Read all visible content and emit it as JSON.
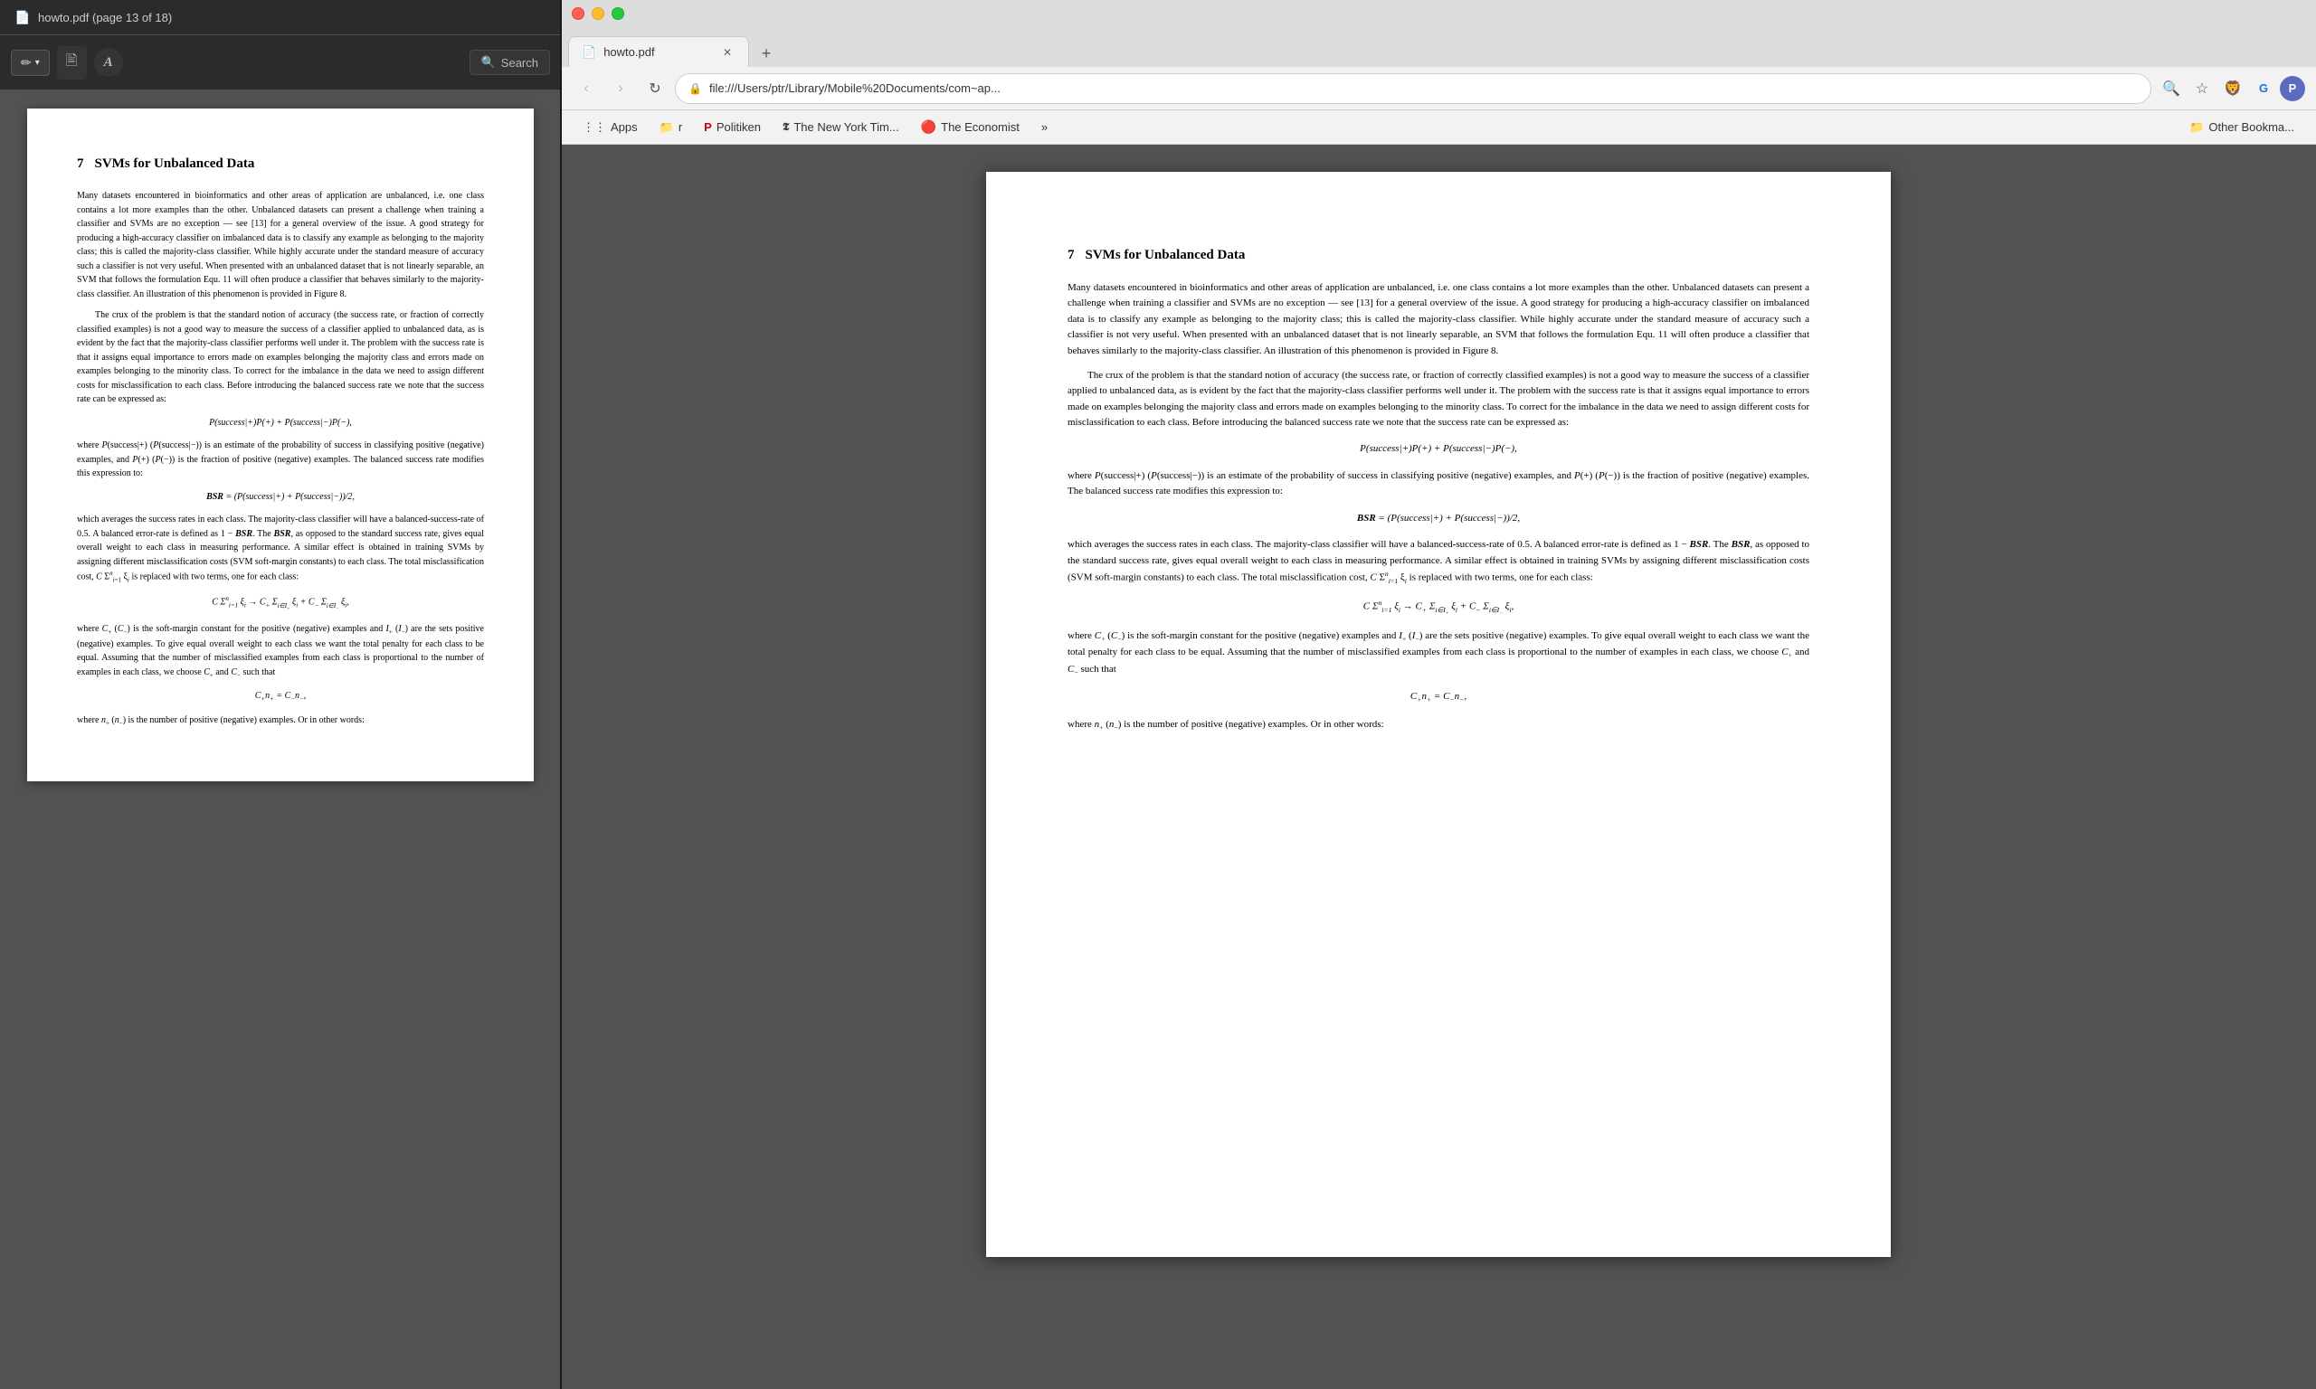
{
  "left_panel": {
    "title": "howto.pdf (page 13 of 18)",
    "toolbar": {
      "pen_label": "✏",
      "pen_dropdown": "▾",
      "stamp_label": "🖹",
      "typewriter_label": "A",
      "search_label": "Search"
    }
  },
  "browser": {
    "tab": {
      "label": "howto.pdf",
      "icon": "📄"
    },
    "address": "file:///Users/ptr/Library/Mobile%20Documents/com~ap...",
    "bookmarks": [
      {
        "type": "apps",
        "label": "Apps",
        "icon": "⋮⋮⋮"
      },
      {
        "type": "folder",
        "label": "r",
        "icon": "📁"
      },
      {
        "type": "site",
        "label": "Politiken",
        "icon": "P"
      },
      {
        "type": "site",
        "label": "The New York Tim...",
        "icon": "NYT"
      },
      {
        "type": "site",
        "label": "The Economist",
        "icon": "🔴"
      },
      {
        "type": "more",
        "label": "»",
        "icon": ""
      },
      {
        "type": "folder",
        "label": "Other Bookma...",
        "icon": "📁"
      }
    ]
  },
  "pdf_content": {
    "section_number": "7",
    "section_title": "SVMs for Unbalanced Data",
    "paragraphs": [
      "Many datasets encountered in bioinformatics and other areas of application are unbalanced, i.e. one class contains a lot more examples than the other.  Unbalanced datasets can present a challenge when training a classifier and SVMs are no exception — see [13] for a general overview of the issue.  A good strategy for producing a high-accuracy classifier on imbalanced data is to classify any example as belonging to the majority class; this is called the majority-class classifier.  While highly accurate under the standard measure of accuracy such a classifier is not very useful.  When presented with an unbalanced dataset that is not linearly separable, an SVM that follows the formulation Equ. 11 will often produce a classifier that behaves similarly to the majority-class classifier.  An illustration of this phenomenon is provided in Figure 8.",
      "The crux of the problem is that the standard notion of accuracy (the success rate, or fraction of correctly classified examples) is not a good way to measure the success of a classifier applied to unbalanced data, as is evident by the fact that the majority-class classifier performs well under it.  The problem with the success rate is that it assigns equal importance to errors made on examples belonging the majority class and errors made on examples belonging to the minority class.  To correct for the imbalance in the data we need to assign different costs for misclassification to each class.  Before introducing the balanced success rate we note that the success rate can be expressed as:"
    ],
    "formula1": "P(success|+)P(+) + P(success|−)P(−),",
    "para2": "where P(success|+) (P(success|−)) is an estimate of the probability of success in classifying positive (negative) examples, and P(+) (P(−)) is the fraction of positive (negative) examples.  The balanced success rate modifies this expression to:",
    "formula2": "BSR = (P(success|+) + P(success|−))/2,",
    "para3": "which averages the success rates in each class.  The majority-class classifier will have a balanced-success-rate of 0.5.  A balanced error-rate is defined as 1 − BSR.  The BSR, as opposed to the standard success rate, gives equal overall weight to each class in measuring performance.  A similar effect is obtained in training SVMs by assigning different misclassification costs (SVM soft-margin constants) to each class.  The total misclassification cost, C Σⁿᵢ₌₁ ξᵢ is replaced with two terms, one for each class:",
    "formula3": "C Σⁿᵢ₌₁ ξᵢ → C₊ Σᵢ∈I₊ ξᵢ + C₋ Σᵢ∈I₋ ξᵢ,",
    "para4": "where C₊ (C₋) is the soft-margin constant for the positive (negative) examples and I₊ (I₋) are the sets positive (negative) examples.  To give equal overall weight to each class we want the total penalty for each class to be equal.  Assuming that the number of misclassified examples from each class is proportional to the number of examples in each class, we choose C₊ and C₋ such that",
    "formula4": "C₊n₊ = C₋n₋,",
    "para5": "where n₊ (n₋) is the number of positive (negative) examples.  Or in other words:"
  }
}
